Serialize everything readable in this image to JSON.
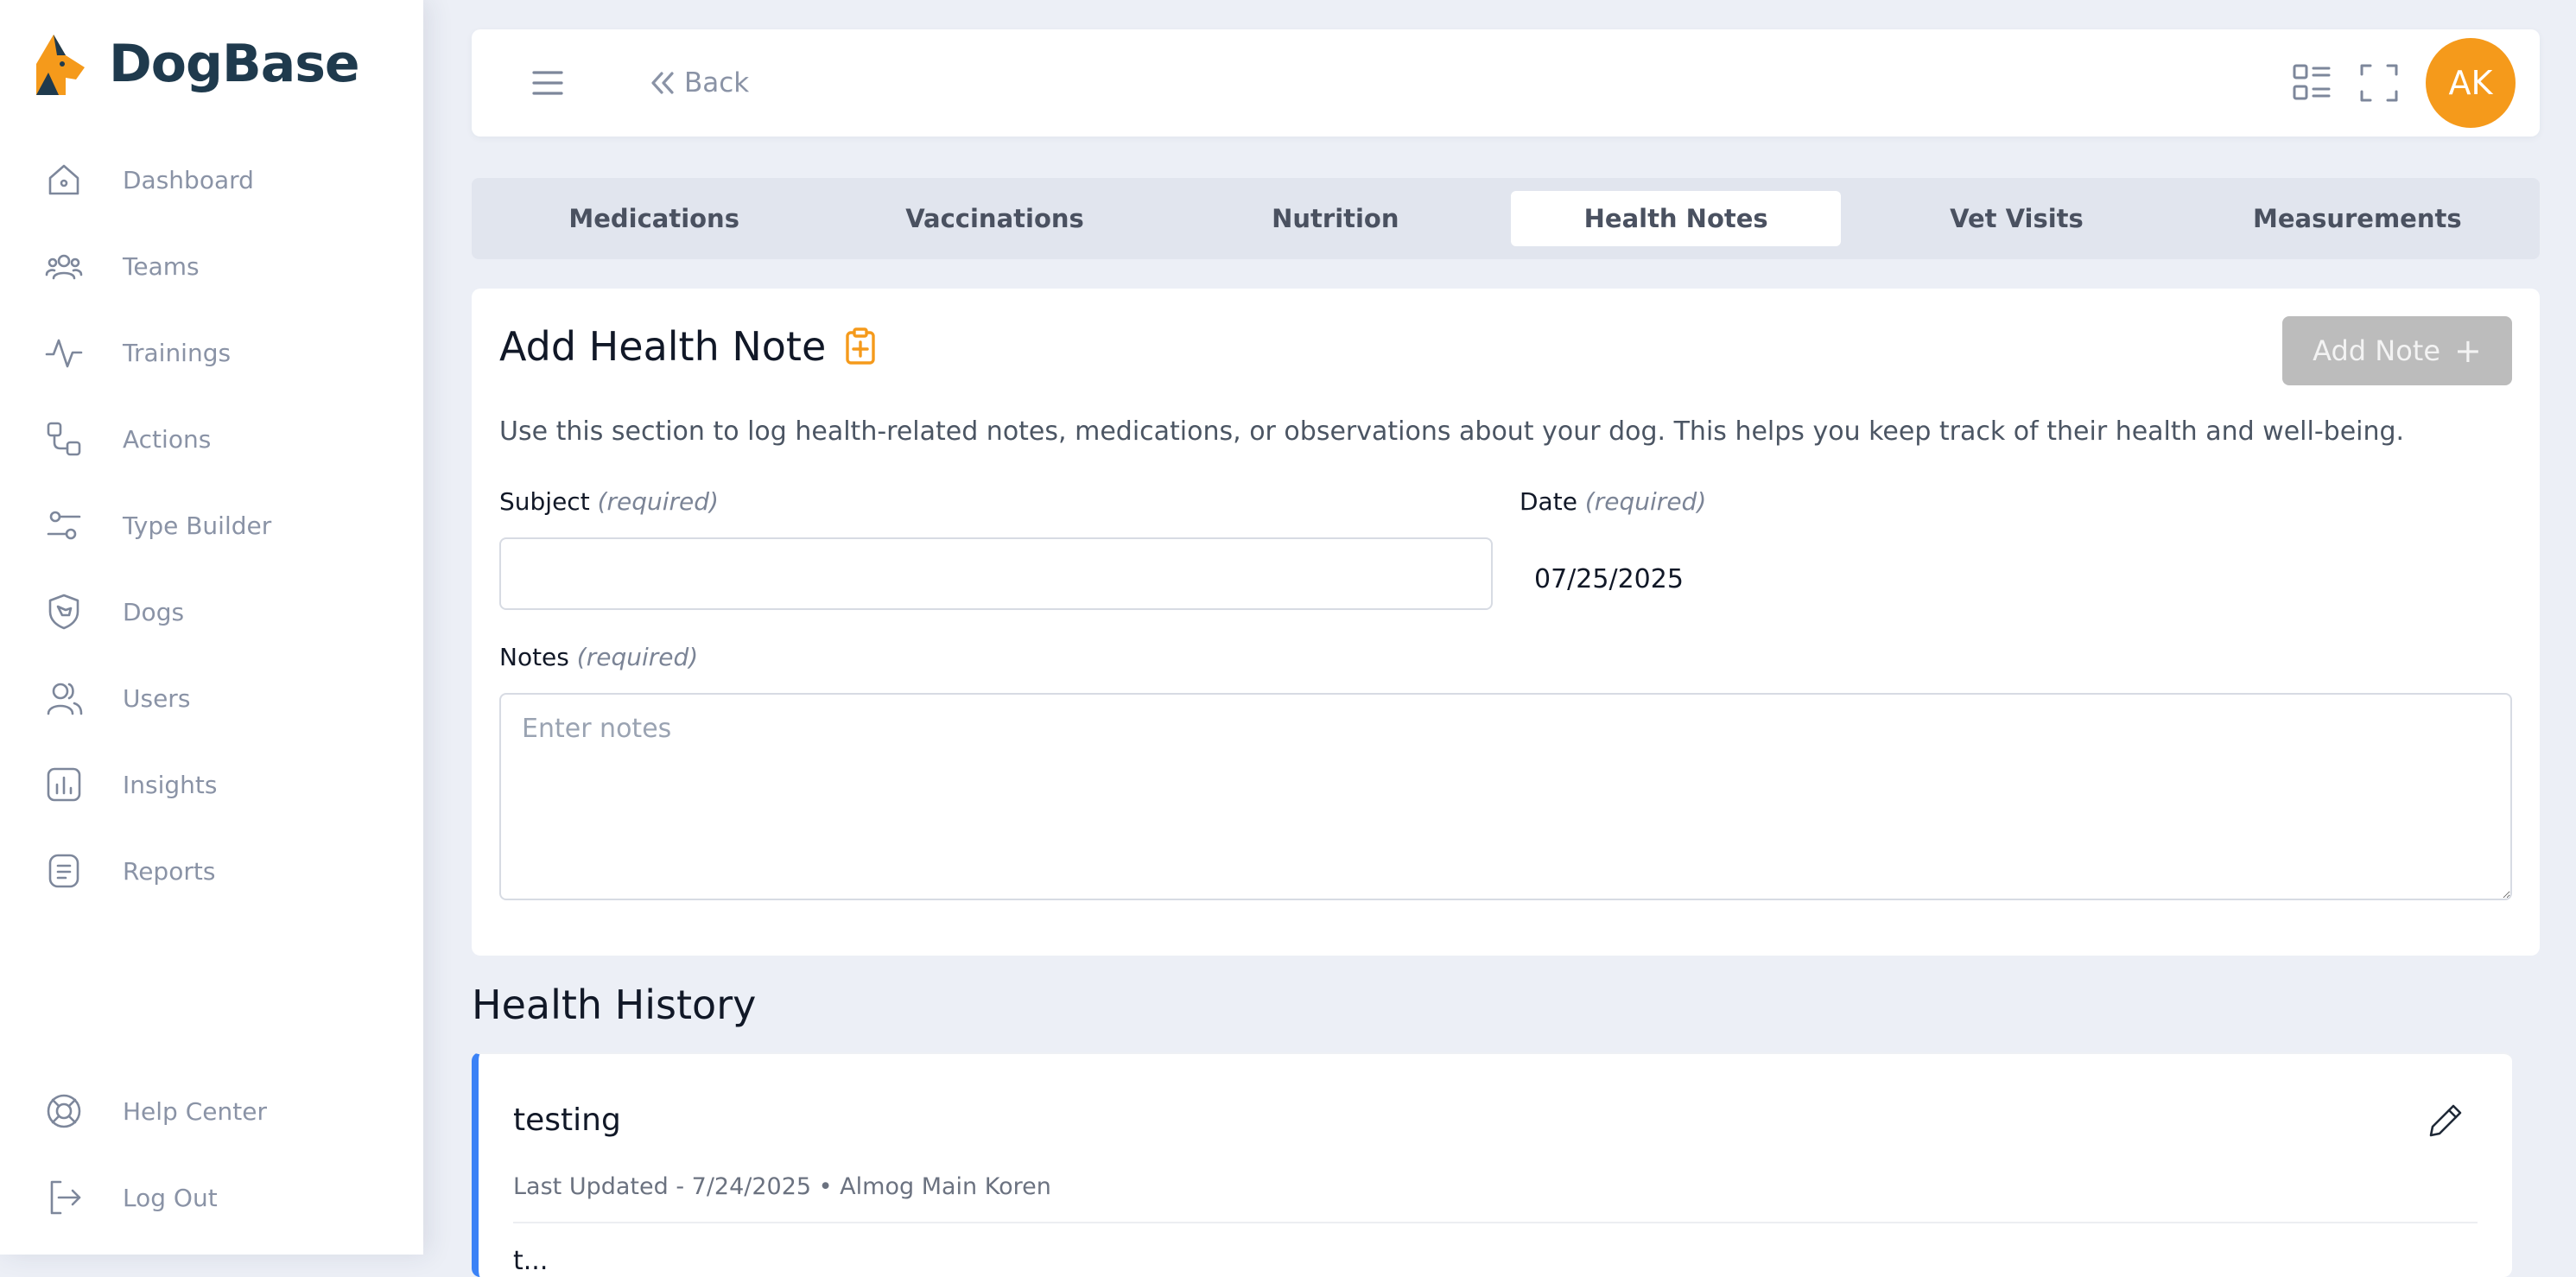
{
  "app": {
    "name": "DogBase"
  },
  "sidebar": {
    "items": [
      {
        "label": "Dashboard",
        "icon": "home-icon"
      },
      {
        "label": "Teams",
        "icon": "teams-icon"
      },
      {
        "label": "Trainings",
        "icon": "activity-icon"
      },
      {
        "label": "Actions",
        "icon": "actions-icon"
      },
      {
        "label": "Type Builder",
        "icon": "sliders-icon"
      },
      {
        "label": "Dogs",
        "icon": "dog-shield-icon"
      },
      {
        "label": "Users",
        "icon": "users-icon"
      },
      {
        "label": "Insights",
        "icon": "chart-icon"
      },
      {
        "label": "Reports",
        "icon": "document-icon"
      }
    ],
    "bottom": [
      {
        "label": "Help Center",
        "icon": "lifebuoy-icon"
      },
      {
        "label": "Log Out",
        "icon": "logout-icon"
      }
    ]
  },
  "topbar": {
    "back_label": "Back",
    "avatar_initials": "AK",
    "avatar_color": "#f59a1b"
  },
  "tabs": [
    {
      "label": "Medications",
      "active": false
    },
    {
      "label": "Vaccinations",
      "active": false
    },
    {
      "label": "Nutrition",
      "active": false
    },
    {
      "label": "Health Notes",
      "active": true
    },
    {
      "label": "Vet Visits",
      "active": false
    },
    {
      "label": "Measurements",
      "active": false
    }
  ],
  "form": {
    "title": "Add Health Note",
    "add_button_label": "Add Note",
    "add_button_plus": "+",
    "description": "Use this section to log health-related notes, medications, or observations about your dog. This helps you keep track of their health and well-being.",
    "subject_label": "Subject",
    "subject_required": "(required)",
    "subject_value": "",
    "date_label": "Date",
    "date_required": "(required)",
    "date_value": "07/25/2025",
    "notes_label": "Notes",
    "notes_required": "(required)",
    "notes_placeholder": "Enter notes"
  },
  "history": {
    "title": "Health History",
    "entries": [
      {
        "title": "testing",
        "meta": "Last Updated - 7/24/2025 • Almog Main Koren",
        "body": "t..."
      }
    ]
  },
  "colors": {
    "accent": "#f59a1b",
    "history_border": "#3b82f6",
    "disabled_button": "#bcbcbc"
  }
}
